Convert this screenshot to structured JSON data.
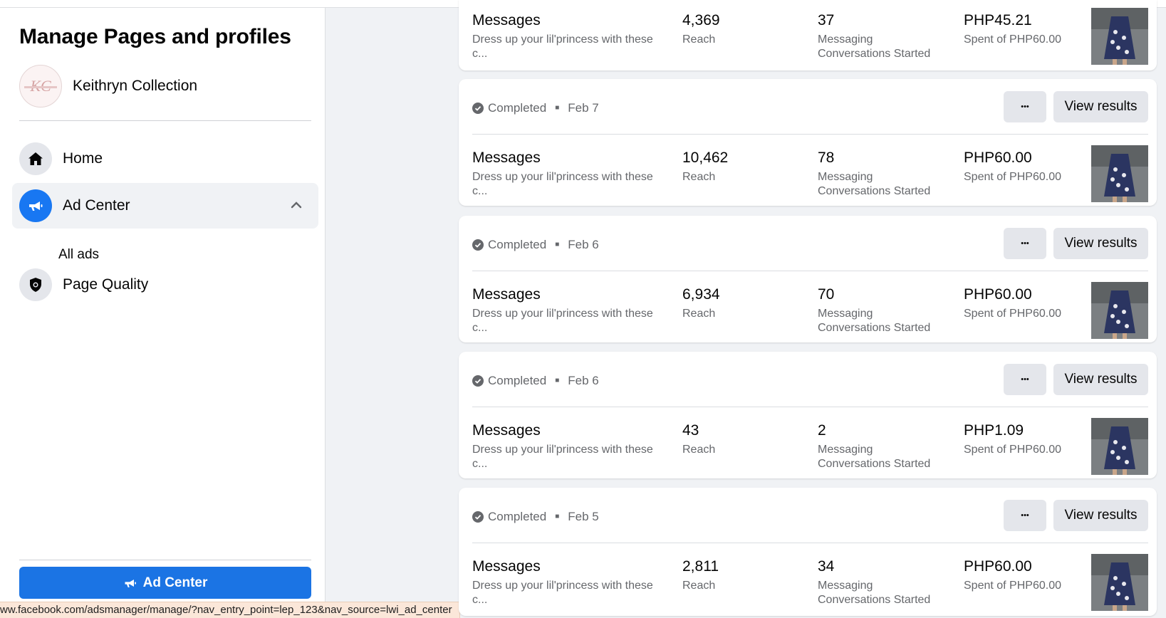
{
  "sidebar": {
    "title": "Manage Pages and profiles",
    "profile": {
      "name": "Keithryn Collection",
      "avatar_text": "KC"
    },
    "nav": {
      "home": "Home",
      "ad_center": "Ad Center",
      "all_ads": "All ads",
      "page_quality": "Page Quality"
    },
    "ad_center_button": "Ad Center"
  },
  "status_url": "ww.facebook.com/adsmanager/manage/?nav_entry_point=lep_123&nav_source=lwi_ad_center",
  "colors": {
    "accent": "#1877f2",
    "button_blue": "#1b74e4",
    "card_bg": "#ffffff",
    "page_bg": "#f0f2f5"
  },
  "actions": {
    "more_label": "•••",
    "view_results": "View results"
  },
  "ads": [
    {
      "status": "",
      "date": "",
      "objective": "Messages",
      "description": "Dress up your lil'princess with these c...",
      "reach": "4,369",
      "reach_label": "Reach",
      "results": "37",
      "results_label_1": "Messaging",
      "results_label_2": "Conversations Started",
      "spent": "PHP45.21",
      "budget": "Spent of PHP60.00"
    },
    {
      "status": "Completed",
      "date": "Feb 7",
      "objective": "Messages",
      "description": "Dress up your lil'princess with these c...",
      "reach": "10,462",
      "reach_label": "Reach",
      "results": "78",
      "results_label_1": "Messaging",
      "results_label_2": "Conversations Started",
      "spent": "PHP60.00",
      "budget": "Spent of PHP60.00"
    },
    {
      "status": "Completed",
      "date": "Feb 6",
      "objective": "Messages",
      "description": "Dress up your lil'princess with these c...",
      "reach": "6,934",
      "reach_label": "Reach",
      "results": "70",
      "results_label_1": "Messaging",
      "results_label_2": "Conversations Started",
      "spent": "PHP60.00",
      "budget": "Spent of PHP60.00"
    },
    {
      "status": "Completed",
      "date": "Feb 6",
      "objective": "Messages",
      "description": "Dress up your lil'princess with these c...",
      "reach": "43",
      "reach_label": "Reach",
      "results": "2",
      "results_label_1": "Messaging",
      "results_label_2": "Conversations Started",
      "spent": "PHP1.09",
      "budget": "Spent of PHP60.00"
    },
    {
      "status": "Completed",
      "date": "Feb 5",
      "objective": "Messages",
      "description": "Dress up your lil'princess with these c...",
      "reach": "2,811",
      "reach_label": "Reach",
      "results": "34",
      "results_label_1": "Messaging",
      "results_label_2": "Conversations Started",
      "spent": "PHP60.00",
      "budget": "Spent of PHP60.00"
    }
  ]
}
